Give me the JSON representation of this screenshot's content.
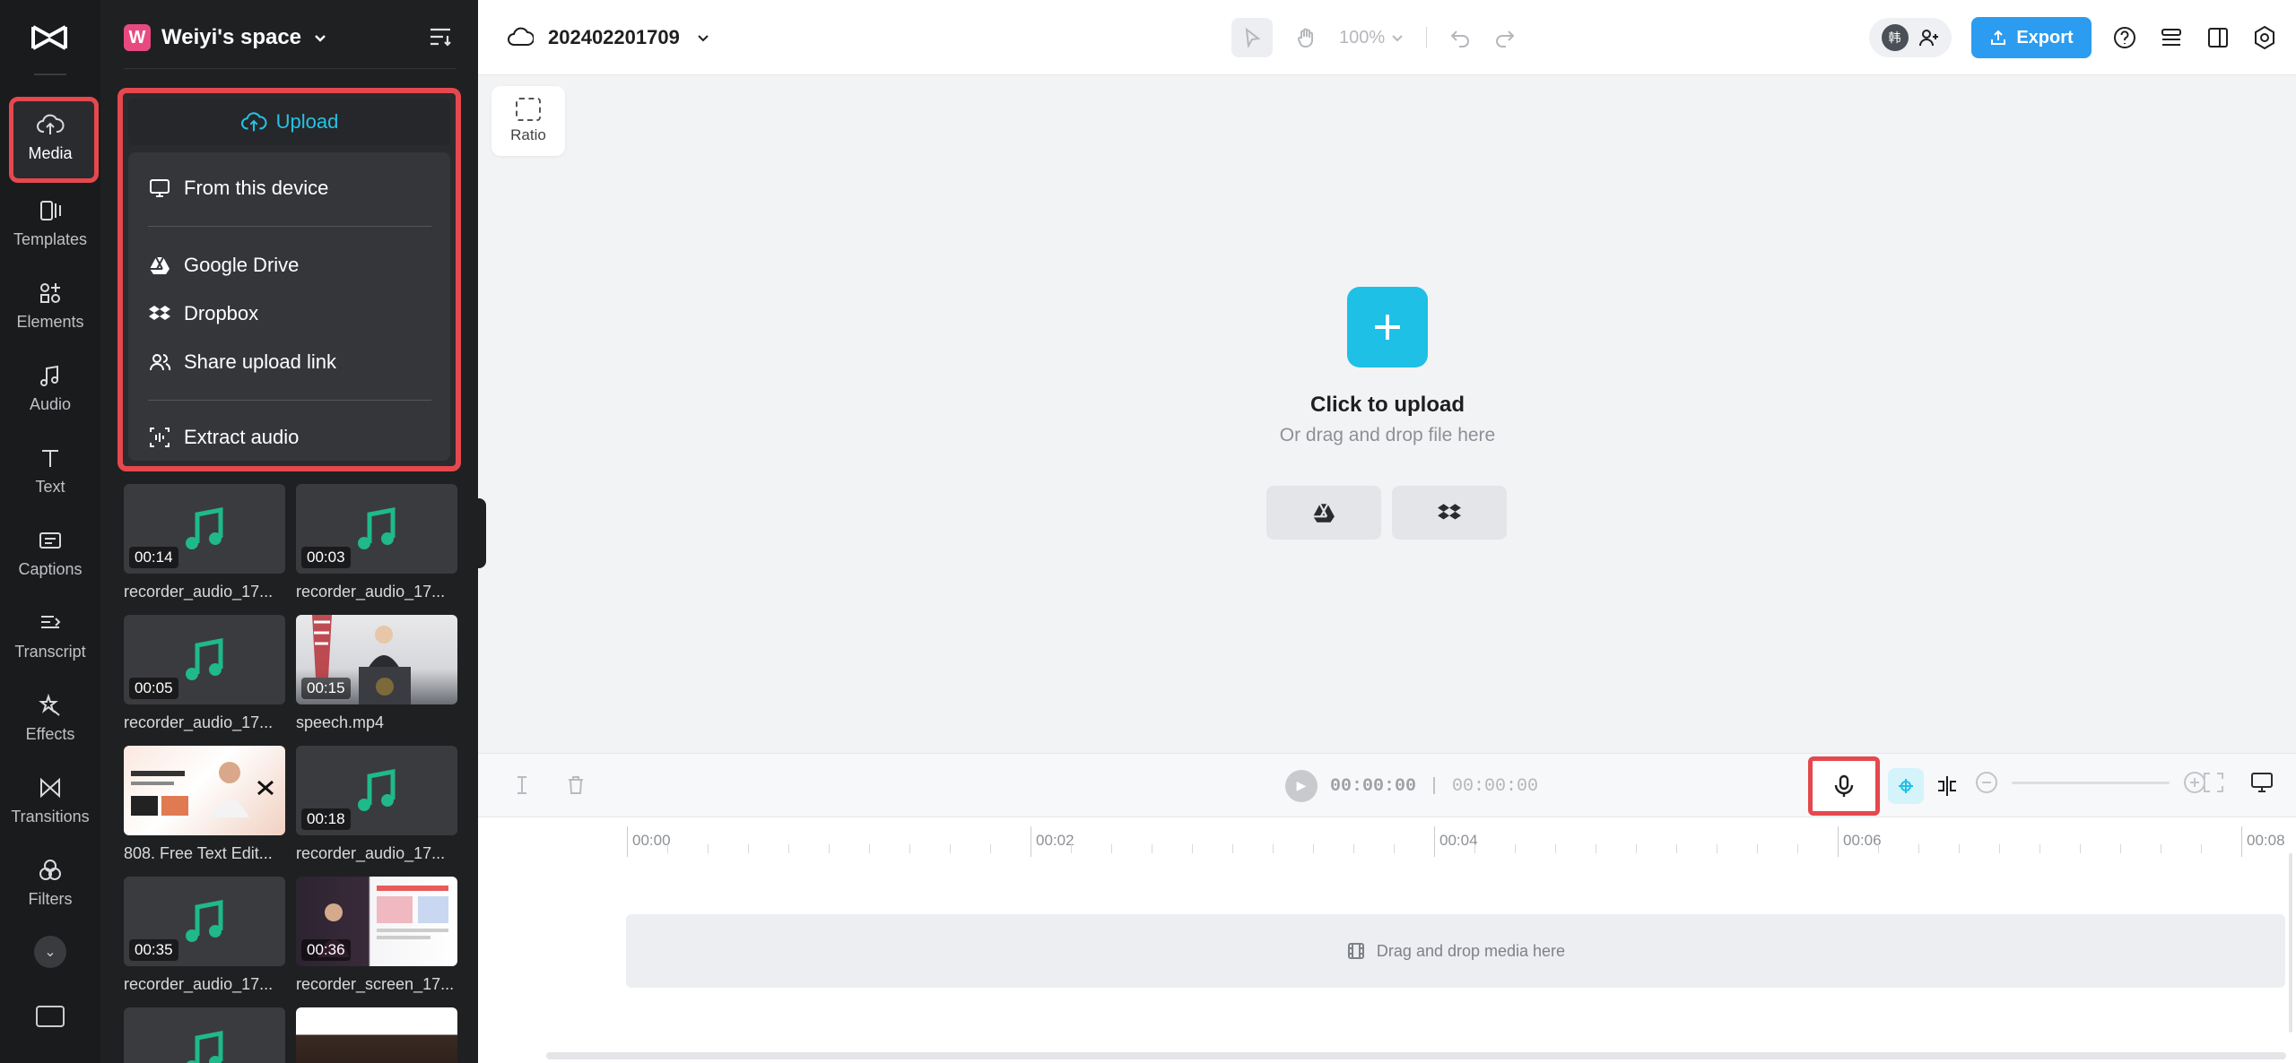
{
  "rail": {
    "items": [
      {
        "label": "Media",
        "icon": "cloud-upload-icon"
      },
      {
        "label": "Templates",
        "icon": "templates-icon"
      },
      {
        "label": "Elements",
        "icon": "elements-icon"
      },
      {
        "label": "Audio",
        "icon": "music-note-icon"
      },
      {
        "label": "Text",
        "icon": "text-icon"
      },
      {
        "label": "Captions",
        "icon": "captions-icon"
      },
      {
        "label": "Transcript",
        "icon": "transcript-icon"
      },
      {
        "label": "Effects",
        "icon": "effects-icon"
      },
      {
        "label": "Transitions",
        "icon": "transitions-icon"
      },
      {
        "label": "Filters",
        "icon": "filters-icon"
      }
    ]
  },
  "panel": {
    "space_initial": "W",
    "space_name": "Weiyi's space",
    "upload_label": "Upload",
    "menu": {
      "from_device": "From this device",
      "google_drive": "Google Drive",
      "dropbox": "Dropbox",
      "share_link": "Share upload link",
      "extract_audio": "Extract audio"
    },
    "media": [
      {
        "name": "recorder_audio_17...",
        "duration": "00:14",
        "kind": "audio"
      },
      {
        "name": "recorder_audio_17...",
        "duration": "00:03",
        "kind": "audio"
      },
      {
        "name": "recorder_audio_17...",
        "duration": "00:05",
        "kind": "audio"
      },
      {
        "name": "speech.mp4",
        "duration": "00:15",
        "kind": "speech"
      },
      {
        "name": "808. Free Text Edit...",
        "duration": "",
        "kind": "free"
      },
      {
        "name": "recorder_audio_17...",
        "duration": "00:18",
        "kind": "audio"
      },
      {
        "name": "recorder_audio_17...",
        "duration": "00:35",
        "kind": "audio"
      },
      {
        "name": "recorder_screen_17...",
        "duration": "00:36",
        "kind": "screen"
      }
    ]
  },
  "topbar": {
    "project_name": "202402201709",
    "zoom": "100%",
    "collab_initial": "韩",
    "export_label": "Export"
  },
  "canvas": {
    "ratio_label": "Ratio",
    "click_to_upload": "Click to upload",
    "drag_drop": "Or drag and drop file here"
  },
  "timeline": {
    "current_time": "00:00:00",
    "separator": "|",
    "total_time": "00:00:00",
    "ticks": [
      "00:00",
      "00:02",
      "00:04",
      "00:06",
      "00:08"
    ],
    "drop_hint": "Drag and drop media here"
  },
  "colors": {
    "accent": "#1ec0e6",
    "export": "#2c9cf0",
    "highlight": "#e5484d",
    "audio_note": "#1fb98a"
  }
}
